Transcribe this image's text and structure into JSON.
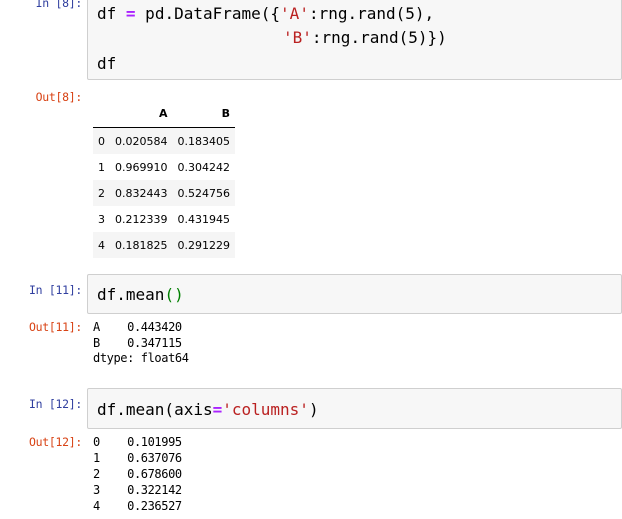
{
  "cells": {
    "c8": {
      "in_prompt": "In [8]:",
      "code_line1_parts": [
        "df ",
        "=",
        " pd.DataFrame({",
        "'A'",
        ":rng.rand(5),"
      ],
      "code_line2_parts": [
        "'B'",
        ":rng.rand(5)})"
      ],
      "code_line3": "df",
      "out_prompt": "Out[8]:",
      "table": {
        "columns": [
          "",
          "A",
          "B"
        ],
        "rows": [
          [
            "0",
            "0.020584",
            "0.183405"
          ],
          [
            "1",
            "0.969910",
            "0.304242"
          ],
          [
            "2",
            "0.832443",
            "0.524756"
          ],
          [
            "3",
            "0.212339",
            "0.431945"
          ],
          [
            "4",
            "0.181825",
            "0.291229"
          ]
        ]
      }
    },
    "c11": {
      "in_prompt": "In [11]:",
      "code_parts": [
        "df.mean",
        "()"
      ],
      "out_prompt": "Out[11]:",
      "output_lines": [
        "A    0.443420",
        "B    0.347115",
        "dtype: float64"
      ]
    },
    "c12": {
      "in_prompt": "In [12]:",
      "code_parts": [
        "df.mean(axis",
        "=",
        "'columns'",
        ")"
      ],
      "out_prompt": "Out[12]:",
      "output_lines": [
        "0    0.101995",
        "1    0.637076",
        "2    0.678600",
        "3    0.322142",
        "4    0.236527"
      ]
    }
  },
  "colors": {
    "in_prompt": "#303f9f",
    "out_prompt": "#d84315",
    "string": "#ba2121",
    "operator": "#aa22ff",
    "cell_bg": "#f7f7f7"
  }
}
